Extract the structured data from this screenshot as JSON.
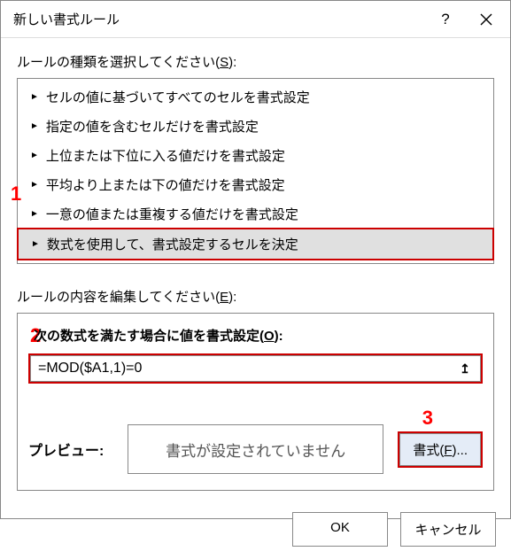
{
  "dialog": {
    "title": "新しい書式ルール"
  },
  "section1": {
    "label_prefix": "ルールの種類を選択してください(",
    "label_key": "S",
    "label_suffix": "):"
  },
  "rules": [
    "セルの値に基づいてすべてのセルを書式設定",
    "指定の値を含むセルだけを書式設定",
    "上位または下位に入る値だけを書式設定",
    "平均より上または下の値だけを書式設定",
    "一意の値または重複する値だけを書式設定",
    "数式を使用して、書式設定するセルを決定"
  ],
  "section2": {
    "label_prefix": "ルールの内容を編集してください(",
    "label_key": "E",
    "label_suffix": "):"
  },
  "edit": {
    "label_prefix": "次の数式を満たす場合に値を書式設定(",
    "label_key": "O",
    "label_suffix": "):",
    "formula": "=MOD($A1,1)=0",
    "ref_icon": "↥"
  },
  "preview": {
    "label": "プレビュー:",
    "text": "書式が設定されていません",
    "button_prefix": "書式(",
    "button_key": "F",
    "button_suffix": ")..."
  },
  "buttons": {
    "ok": "OK",
    "cancel": "キャンセル"
  },
  "annotations": {
    "m1": "1",
    "m2": "2",
    "m3": "3"
  }
}
